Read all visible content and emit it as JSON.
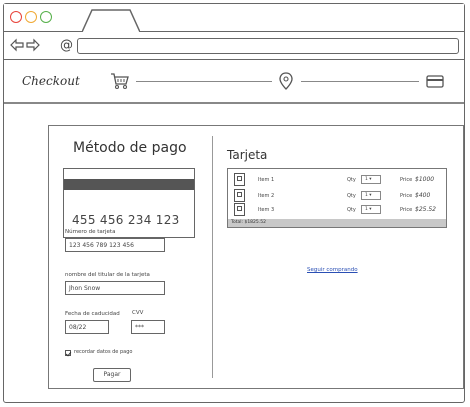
{
  "browser": {
    "buttons": [
      {
        "name": "close",
        "color": "#e8433a"
      },
      {
        "name": "minimize",
        "color": "#f0a935"
      },
      {
        "name": "maximize",
        "color": "#56b04a"
      }
    ],
    "address_prefix": "@",
    "url": ""
  },
  "header": {
    "title": "Checkout",
    "steps": [
      {
        "icon": "cart-icon"
      },
      {
        "icon": "location-pin-icon"
      },
      {
        "icon": "credit-card-icon"
      }
    ]
  },
  "payment_form": {
    "title": "Método de pago",
    "card_number_display": "455 456 234 123",
    "card_number_label": "Número de tarjeta",
    "card_number_value": "123 456 789 123 456",
    "holder_label": "nombre del titular de la tarjeta",
    "holder_value": "Jhon Snow",
    "expiry_label": "Fecha de caducidad",
    "expiry_value": "08/22",
    "cvv_label": "CVV",
    "cvv_value": "***",
    "remember_label": "recordar datos de pago",
    "remember_checked": true,
    "pay_button": "Pagar"
  },
  "cart": {
    "title": "Tarjeta",
    "qty_label": "Qty",
    "price_label": "Price",
    "items": [
      {
        "name": "Item 1",
        "qty": "1",
        "price": "$1000"
      },
      {
        "name": "Item 2",
        "qty": "1",
        "price": "$400"
      },
      {
        "name": "Item 3",
        "qty": "1",
        "price": "$25.52"
      }
    ],
    "total": "Total: $1825.52",
    "continue_link": "Seguir comprando"
  }
}
